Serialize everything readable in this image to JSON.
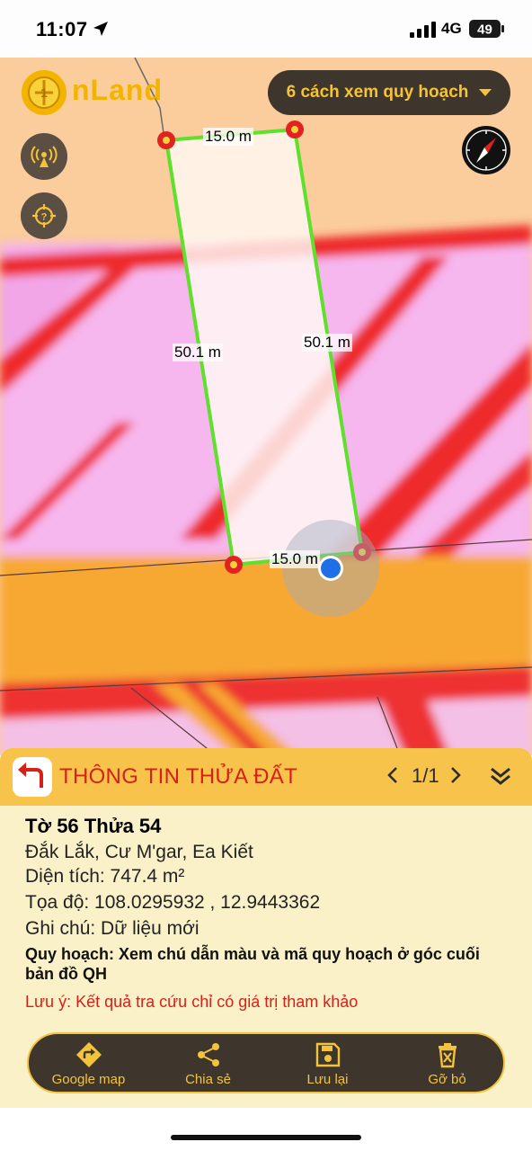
{
  "status": {
    "time": "11:07",
    "network": "4G",
    "battery": "49"
  },
  "app": {
    "logo_text": "nLand"
  },
  "map": {
    "dropdown_label": "6 cách xem quy hoạch",
    "dimensions": {
      "top": "15.0 m",
      "left": "50.1 m",
      "right": "50.1 m",
      "bottom": "15.0 m"
    }
  },
  "panel": {
    "title": "THÔNG TIN THỬA ĐẤT",
    "pager": "1/1",
    "parcel_name": "Tờ 56 Thửa 54",
    "location": "Đắk Lắk, Cư M'gar, Ea Kiết",
    "area": "Diện tích: 747.4 m²",
    "coords": "Tọa độ: 108.0295932 , 12.9443362",
    "note": "Ghi chú: Dữ liệu mới",
    "planning": "Quy hoạch: Xem chú dẫn màu và mã quy hoạch ở góc cuối bản đồ QH",
    "warning": "Lưu ý: Kết quả tra cứu chỉ có giá trị tham khảo"
  },
  "toolbar": {
    "google_map": "Google map",
    "share": "Chia sẻ",
    "save": "Lưu lại",
    "remove": "Gỡ bỏ"
  },
  "colors": {
    "accent": "#f7c34a",
    "dark": "#3e362d",
    "title_red": "#d7201a",
    "parcel_green": "#5ee02c"
  }
}
